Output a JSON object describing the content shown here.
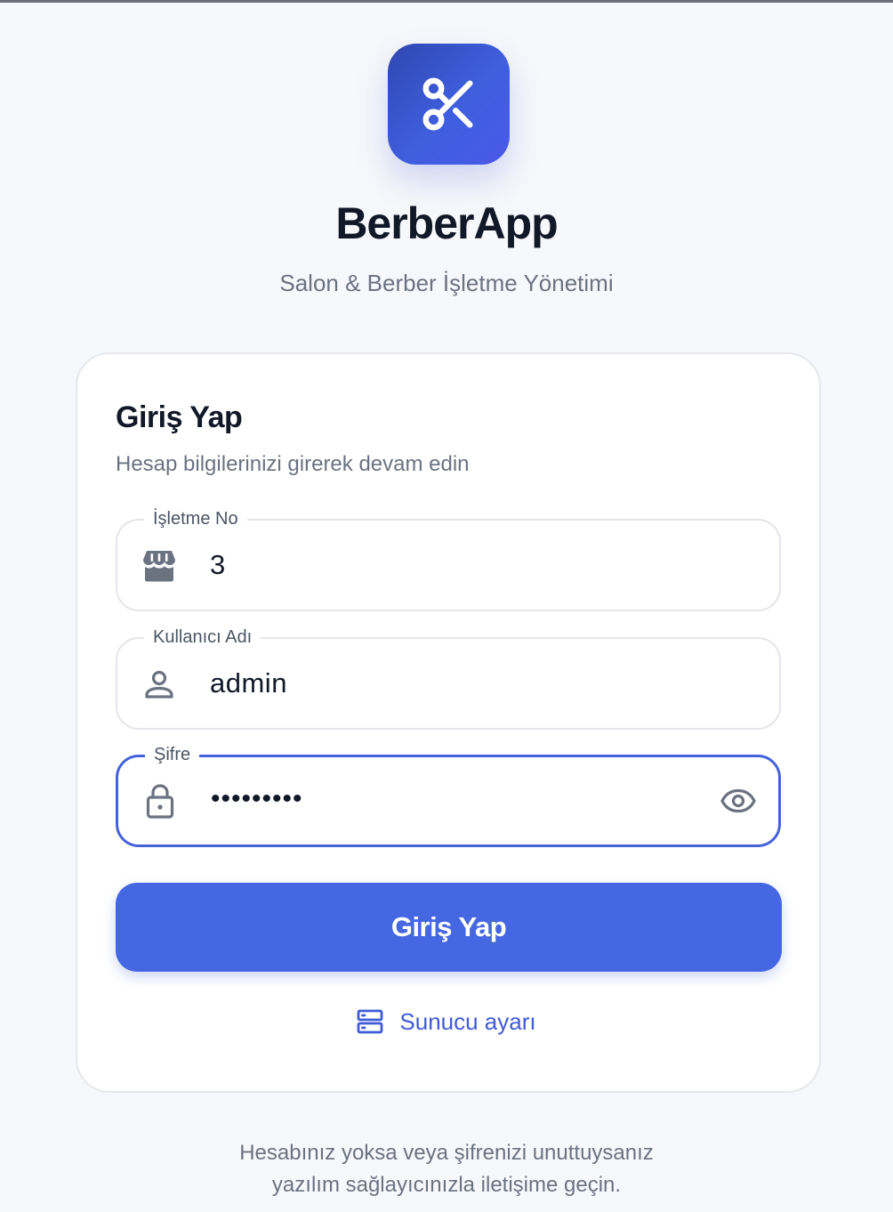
{
  "app": {
    "name": "BerberApp",
    "subtitle": "Salon & Berber İşletme Yönetimi",
    "logo_icon": "scissors-icon",
    "accent_color": "#4567e2"
  },
  "login_card": {
    "title": "Giriş Yap",
    "description": "Hesap bilgilerinizi girerek devam edin",
    "fields": [
      {
        "label": "İşletme No",
        "value": "3",
        "icon": "store-icon"
      },
      {
        "label": "Kullanıcı Adı",
        "value": "admin",
        "icon": "user-icon"
      },
      {
        "label": "Şifre",
        "value": "•••••••••",
        "icon": "lock-icon",
        "trailing_icon": "eye-icon",
        "focused": true
      }
    ],
    "submit_label": "Giriş Yap",
    "server_settings_label": "Sunucu ayarı",
    "server_settings_icon": "server-icon"
  },
  "footer": {
    "line1": "Hesabınız yoksa veya şifrenizi unuttuysanız",
    "line2": "yazılım sağlayıcınızla iletişime geçin."
  }
}
